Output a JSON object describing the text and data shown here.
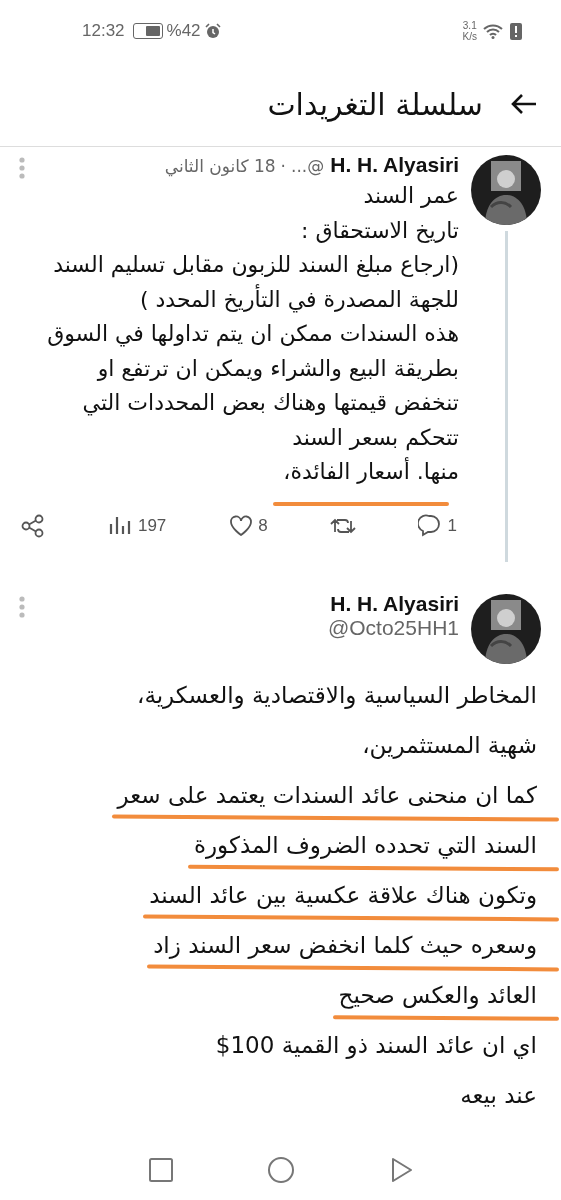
{
  "status_bar": {
    "time": "12:32",
    "battery_percent": "%42",
    "speed_value": "3.1",
    "speed_unit": "K/s"
  },
  "header": {
    "title": "سلسلة التغريدات"
  },
  "tweets": [
    {
      "name": "H. H. Alyasiri",
      "handle": "@...",
      "separator": "·",
      "date": "18 كانون الثاني",
      "compact": true,
      "thread_line": true,
      "lines": [
        {
          "text": "عمر السند",
          "underlined": false
        },
        {
          "text": "تاريخ الاستحقاق :",
          "underlined": false
        },
        {
          "text": "(ارجاع مبلغ السند للزبون مقابل تسليم السند",
          "underlined": false
        },
        {
          "text": "للجهة المصدرة في التأريخ المحدد )",
          "underlined": false
        },
        {
          "text": "هذه السندات ممكن ان يتم تداولها في السوق",
          "underlined": false
        },
        {
          "text": "بطريقة البيع والشراء ويمكن ان ترتفع او",
          "underlined": false
        },
        {
          "text": "تنخفض قيمتها وهناك بعض المحددات التي",
          "underlined": false
        },
        {
          "text": "تتحكم بسعر السند",
          "underlined": false
        },
        {
          "text": "منها. أسعار الفائدة،",
          "underlined": true
        }
      ],
      "actions": [
        {
          "kind": "reply",
          "count": "1"
        },
        {
          "kind": "retweet"
        },
        {
          "kind": "like",
          "count": "8"
        },
        {
          "kind": "views",
          "count": "197"
        },
        {
          "kind": "share"
        }
      ]
    },
    {
      "name": "H. H. Alyasiri",
      "handle": "@Octo25HH1",
      "compact": false,
      "thread_line": false,
      "lines": [
        {
          "text": "المخاطر السياسية والاقتصادية والعسكرية،",
          "underlined": false
        },
        {
          "text": "شهية المستثمرين،",
          "underlined": false
        },
        {
          "text": "كما ان منحنى عائد السندات يعتمد على سعر",
          "underlined": true
        },
        {
          "text": "السند التي تحدده الضروف المذكورة",
          "underlined": true
        },
        {
          "text": "وتكون هناك علاقة عكسية بين عائد السند",
          "underlined": true
        },
        {
          "text": "وسعره حيث كلما انخفض سعر السند زاد",
          "underlined": true
        },
        {
          "text": "العائد والعكس صحيح",
          "underlined": true
        },
        {
          "text": "اي ان عائد السند ذو القمية 100$",
          "underlined": false
        },
        {
          "text": "عند بيعه",
          "underlined": false
        }
      ]
    }
  ]
}
